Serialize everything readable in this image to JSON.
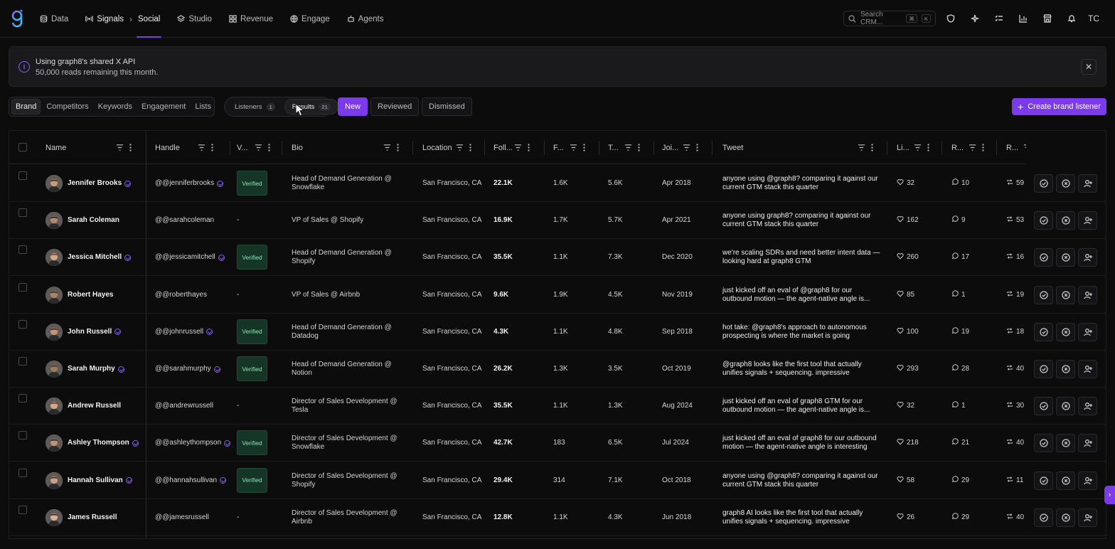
{
  "app": {
    "avatar_initials": "TC"
  },
  "nav": {
    "items": [
      {
        "label": "Data",
        "icon": "database-icon"
      },
      {
        "label": "Signals",
        "icon": "signal-icon"
      },
      {
        "label": "Studio",
        "icon": "studio-icon"
      },
      {
        "label": "Revenue",
        "icon": "grid-icon"
      },
      {
        "label": "Engage",
        "icon": "globe-icon"
      },
      {
        "label": "Agents",
        "icon": "bot-icon"
      }
    ],
    "breadcrumb_current": "Social",
    "search_placeholder": "Search CRM...",
    "search_kbd": [
      "⌘",
      "K"
    ]
  },
  "banner": {
    "line1": "Using graph8's shared X API",
    "line2": "50,000 reads remaining this month."
  },
  "tabs": {
    "category": [
      "Brand",
      "Competitors",
      "Keywords",
      "Engagement",
      "Lists"
    ],
    "category_selected": "Brand",
    "view": [
      {
        "label": "Listeners",
        "count": "1"
      },
      {
        "label": "Results",
        "count": "21"
      }
    ],
    "view_selected": "Results",
    "status": [
      "New",
      "Reviewed",
      "Dismissed"
    ],
    "status_selected": "New",
    "create_label": "Create brand listener"
  },
  "columns": [
    "Name",
    "Handle",
    "V...",
    "Bio",
    "Location",
    "Foll...",
    "F...",
    "T...",
    "Joi...",
    "Tweet",
    "Li...",
    "R...",
    "R..."
  ],
  "rows": [
    {
      "name": "Jennifer Brooks",
      "verified": true,
      "handle": "@@jenniferbrooks",
      "badge": "Verified",
      "bio": "Head of Demand Generation @ Snowflake",
      "location": "San Francisco, CA",
      "followers": "22.1K",
      "following": "1.6K",
      "tweets": "5.6K",
      "joined": "Apr 2018",
      "tweet": "anyone using @graph8? comparing it against our current GTM stack this quarter",
      "likes": "32",
      "replies": "10",
      "retweets": "59"
    },
    {
      "name": "Sarah Coleman",
      "verified": false,
      "handle": "@@sarahcoleman",
      "badge": "-",
      "bio": "VP of Sales @ Shopify",
      "location": "San Francisco, CA",
      "followers": "16.9K",
      "following": "1.7K",
      "tweets": "5.7K",
      "joined": "Apr 2021",
      "tweet": "anyone using graph8? comparing it against our current GTM stack this quarter",
      "likes": "162",
      "replies": "9",
      "retweets": "53"
    },
    {
      "name": "Jessica Mitchell",
      "verified": true,
      "handle": "@@jessicamitchell",
      "badge": "Verified",
      "bio": "Head of Demand Generation @ Shopify",
      "location": "San Francisco, CA",
      "followers": "35.5K",
      "following": "1.1K",
      "tweets": "7.3K",
      "joined": "Dec 2020",
      "tweet": "we're scaling SDRs and need better intent data — looking hard at graph8 GTM",
      "likes": "260",
      "replies": "17",
      "retweets": "16"
    },
    {
      "name": "Robert Hayes",
      "verified": false,
      "handle": "@@roberthayes",
      "badge": "-",
      "bio": "VP of Sales @ Airbnb",
      "location": "San Francisco, CA",
      "followers": "9.6K",
      "following": "1.9K",
      "tweets": "4.5K",
      "joined": "Nov 2019",
      "tweet": "just kicked off an eval of @graph8 for our outbound motion — the agent-native angle is...",
      "likes": "85",
      "replies": "1",
      "retweets": "19"
    },
    {
      "name": "John Russell",
      "verified": true,
      "handle": "@@johnrussell",
      "badge": "Verified",
      "bio": "Head of Demand Generation @ Datadog",
      "location": "San Francisco, CA",
      "followers": "4.3K",
      "following": "1.1K",
      "tweets": "4.8K",
      "joined": "Sep 2018",
      "tweet": "hot take: @graph8's approach to autonomous prospecting is where the market is going",
      "likes": "100",
      "replies": "19",
      "retweets": "18"
    },
    {
      "name": "Sarah Murphy",
      "verified": true,
      "handle": "@@sarahmurphy",
      "badge": "Verified",
      "bio": "Head of Demand Generation @ Notion",
      "location": "San Francisco, CA",
      "followers": "26.2K",
      "following": "1.3K",
      "tweets": "3.5K",
      "joined": "Oct 2019",
      "tweet": "@graph8 looks like the first tool that actually unifies signals + sequencing. impressive",
      "likes": "293",
      "replies": "28",
      "retweets": "40"
    },
    {
      "name": "Andrew Russell",
      "verified": false,
      "handle": "@@andrewrussell",
      "badge": "-",
      "bio": "Director of Sales Development @ Tesla",
      "location": "San Francisco, CA",
      "followers": "35.5K",
      "following": "1.1K",
      "tweets": "1.3K",
      "joined": "Aug 2024",
      "tweet": "just kicked off an eval of graph8 GTM for our outbound motion — the agent-native angle is...",
      "likes": "32",
      "replies": "1",
      "retweets": "30"
    },
    {
      "name": "Ashley Thompson",
      "verified": true,
      "handle": "@@ashleythompson",
      "badge": "Verified",
      "bio": "Director of Sales Development @ Snowflake",
      "location": "San Francisco, CA",
      "followers": "42.7K",
      "following": "183",
      "tweets": "6.5K",
      "joined": "Jul 2024",
      "tweet": "just kicked off an eval of graph8 for our outbound motion — the agent-native angle is interesting",
      "likes": "218",
      "replies": "21",
      "retweets": "40"
    },
    {
      "name": "Hannah Sullivan",
      "verified": true,
      "handle": "@@hannahsullivan",
      "badge": "Verified",
      "bio": "Director of Sales Development @ Shopify",
      "location": "San Francisco, CA",
      "followers": "29.4K",
      "following": "314",
      "tweets": "7.1K",
      "joined": "Oct 2018",
      "tweet": "anyone using @graph8? comparing it against our current GTM stack this quarter",
      "likes": "58",
      "replies": "29",
      "retweets": "11"
    },
    {
      "name": "James Russell",
      "verified": false,
      "handle": "@@jamesrussell",
      "badge": "-",
      "bio": "Director of Sales Development @ Airbnb",
      "location": "San Francisco, CA",
      "followers": "12.8K",
      "following": "1.1K",
      "tweets": "4.3K",
      "joined": "Jun 2018",
      "tweet": "graph8 AI looks like the first tool that actually unifies signals + sequencing. impressive",
      "likes": "26",
      "replies": "29",
      "retweets": "40"
    }
  ],
  "colors": {
    "accent": "#7c3aed",
    "verified_bg": "#153527",
    "verified_text": "#8fe0b5"
  }
}
